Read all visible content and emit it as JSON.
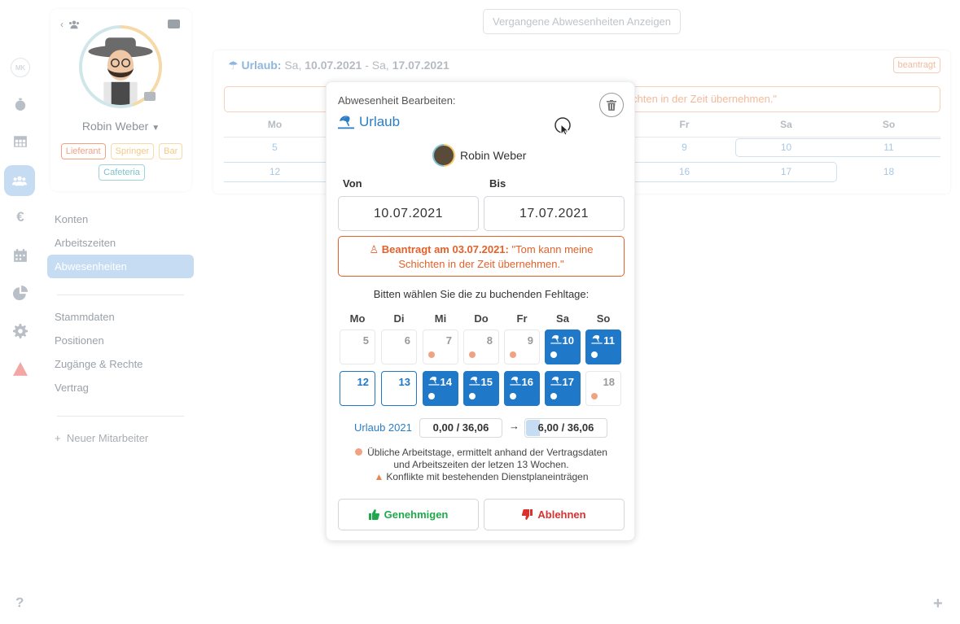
{
  "rail": {
    "initials": "MK"
  },
  "profile": {
    "name": "Robin Weber",
    "tags": [
      {
        "label": "Lieferant",
        "color": "#f0a383"
      },
      {
        "label": "Springer",
        "color": "#f5d9a6"
      },
      {
        "label": "Bar",
        "color": "#f5d9a6"
      },
      {
        "label": "Cafeteria",
        "color": "#9fd3da"
      }
    ]
  },
  "menu": {
    "items": [
      "Konten",
      "Arbeitszeiten",
      "Abwesenheiten"
    ],
    "items2": [
      "Stammdaten",
      "Positionen",
      "Zugänge & Rechte",
      "Vertrag"
    ],
    "new_employee": "Neuer Mitarbeiter"
  },
  "top": {
    "past_absences": "Vergangene Abwesenheiten Anzeigen"
  },
  "background": {
    "type": "Urlaub:",
    "range_prefix": "Sa,",
    "from": "10.07.2021",
    "mid": "- Sa,",
    "to": "17.07.2021",
    "badge": "beantragt",
    "note": "chten in der Zeit übernehmen.\"",
    "weekdays": [
      "Mo",
      "",
      "",
      "",
      "Fr",
      "Sa",
      "So"
    ],
    "row1": [
      "5",
      "",
      "",
      "",
      "9",
      "10",
      "11"
    ],
    "row2": [
      "12",
      "",
      "",
      "",
      "16",
      "17",
      "18"
    ]
  },
  "popover": {
    "subtitle": "Abwesenheit Bearbeiten:",
    "type": "Urlaub",
    "employee": "Robin Weber",
    "von_label": "Von",
    "bis_label": "Bis",
    "von_value": "10.07.2021",
    "bis_value": "17.07.2021",
    "request_bold": "Beantragt am 03.07.2021:",
    "request_text": "\"Tom kann meine Schichten in der Zeit übernehmen.\"",
    "choose": "Bitten wählen Sie die zu buchenden Fehltage:",
    "weekdays": [
      "Mo",
      "Di",
      "Mi",
      "Do",
      "Fr",
      "Sa",
      "So"
    ],
    "week1": [
      {
        "d": "5",
        "state": "plain",
        "dot": false
      },
      {
        "d": "6",
        "state": "plain",
        "dot": false
      },
      {
        "d": "7",
        "state": "plain",
        "dot": true
      },
      {
        "d": "8",
        "state": "plain",
        "dot": true
      },
      {
        "d": "9",
        "state": "plain",
        "dot": true
      },
      {
        "d": "10",
        "state": "sel",
        "dot": true
      },
      {
        "d": "11",
        "state": "sel",
        "dot": true
      }
    ],
    "week2": [
      {
        "d": "12",
        "state": "out",
        "dot": false
      },
      {
        "d": "13",
        "state": "out",
        "dot": false
      },
      {
        "d": "14",
        "state": "sel",
        "dot": true
      },
      {
        "d": "15",
        "state": "sel",
        "dot": true
      },
      {
        "d": "16",
        "state": "sel",
        "dot": true
      },
      {
        "d": "17",
        "state": "sel",
        "dot": true
      },
      {
        "d": "18",
        "state": "plain",
        "dot": true
      }
    ],
    "balance_label": "Urlaub 2021",
    "balance_before": "0,00 / 36,06",
    "balance_after": "6,00 / 36,06",
    "balance_after_fraction": 0.166,
    "legend1": "Übliche Arbeitstage, ermittelt anhand der Vertragsdaten",
    "legend2": "und Arbeitszeiten der letzen 13 Wochen.",
    "legend3": "Konflikte mit bestehenden Dienstplaneinträgen",
    "approve": "Genehmigen",
    "reject": "Ablehnen"
  },
  "colors": {
    "accent": "#1f78c8",
    "orange": "#e2612b",
    "green": "#1eaa4b",
    "red": "#d9312e"
  },
  "footer": {
    "help": "?",
    "add": "+"
  }
}
